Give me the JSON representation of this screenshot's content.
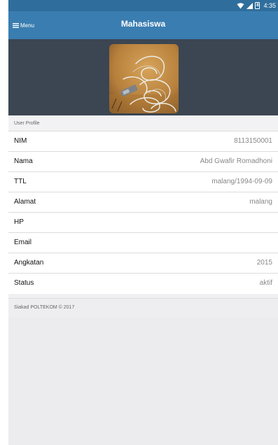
{
  "status_bar": {
    "time": "4:35",
    "battery_level": "8"
  },
  "header": {
    "menu_label": "Menu",
    "title": "Mahasiswa"
  },
  "section": {
    "title": "User Profile"
  },
  "profile_rows": [
    {
      "label": "NIM",
      "value": "8113150001"
    },
    {
      "label": "Nama",
      "value": "Abd Gwafir Romadhoni"
    },
    {
      "label": "TTL",
      "value": "malang/1994-09-09"
    },
    {
      "label": "Alamat",
      "value": "malang"
    },
    {
      "label": "HP",
      "value": ""
    },
    {
      "label": "Email",
      "value": ""
    },
    {
      "label": "Angkatan",
      "value": "2015"
    },
    {
      "label": "Status",
      "value": "aktif"
    }
  ],
  "footer": {
    "text": "Siakad POLTEKOM © 2017"
  },
  "colors": {
    "status_bar": "#2f6e9c",
    "app_bar": "#3a7db0",
    "photo_background": "#3b4652"
  }
}
